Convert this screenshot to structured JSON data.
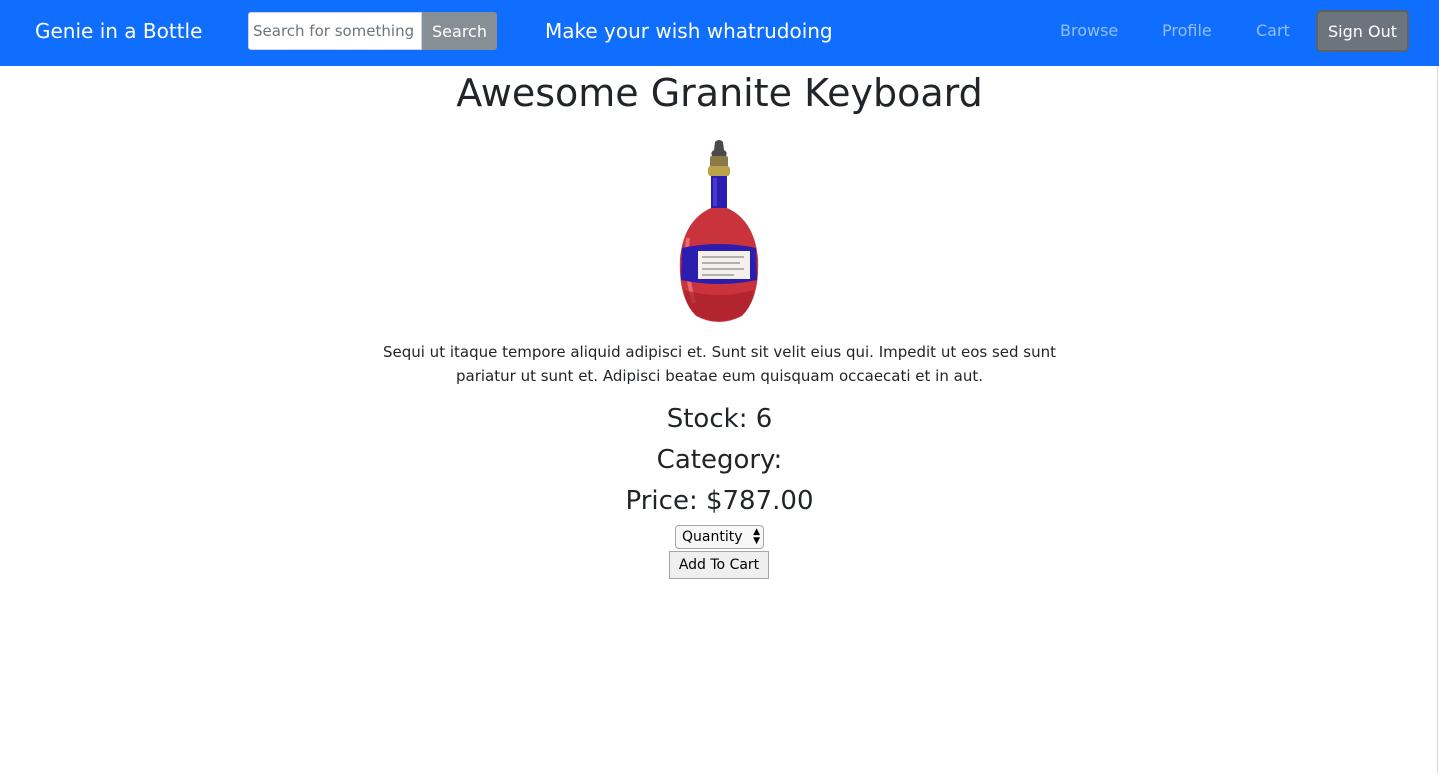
{
  "navbar": {
    "brand": "Genie in a Bottle",
    "search_placeholder": "Search for something",
    "search_label": "Search",
    "tagline": "Make your wish whatrudoing",
    "links": {
      "browse": "Browse",
      "profile": "Profile",
      "cart": "Cart"
    },
    "signout_label": "Sign Out",
    "color": "#0f6efd"
  },
  "product": {
    "title": "Awesome Granite Keyboard",
    "image_icon": "bottle-image",
    "description": "Sequi ut itaque tempore aliquid adipisci et. Sunt sit velit eius qui. Impedit ut eos sed sunt pariatur ut sunt et. Adipisci beatae eum quisquam occaecati et in aut.",
    "stock_text": "Stock: 6",
    "category_text": "Category:",
    "price_text": "Price: $787.00",
    "quantity_selected": "Quantity",
    "add_to_cart_label": "Add To Cart"
  }
}
